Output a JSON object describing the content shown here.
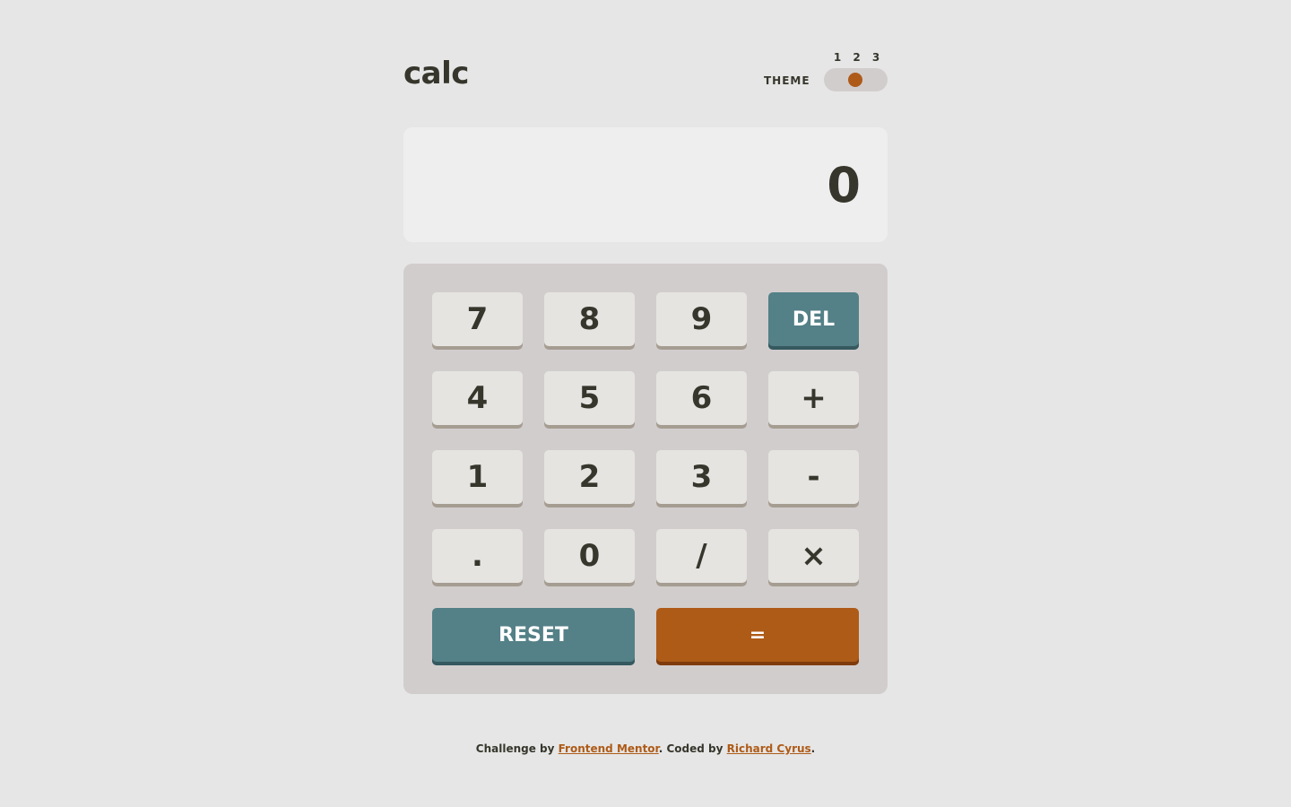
{
  "header": {
    "logo": "calc",
    "theme_label": "THEME",
    "theme_options": [
      "1",
      "2",
      "3"
    ]
  },
  "display": {
    "value": "0"
  },
  "keypad": {
    "keys": [
      "7",
      "8",
      "9",
      "DEL",
      "4",
      "5",
      "6",
      "+",
      "1",
      "2",
      "3",
      "-",
      ".",
      "0",
      "/",
      "×"
    ],
    "reset": "RESET",
    "equals": "="
  },
  "footer": {
    "prefix": "Challenge by ",
    "link1": "Frontend Mentor",
    "middle": ". Coded by ",
    "link2": "Richard Cyrus",
    "suffix": "."
  },
  "colors": {
    "background": "#e6e6e6",
    "accent": "#ae5b17",
    "del_reset": "#548087",
    "text": "#36362c"
  }
}
